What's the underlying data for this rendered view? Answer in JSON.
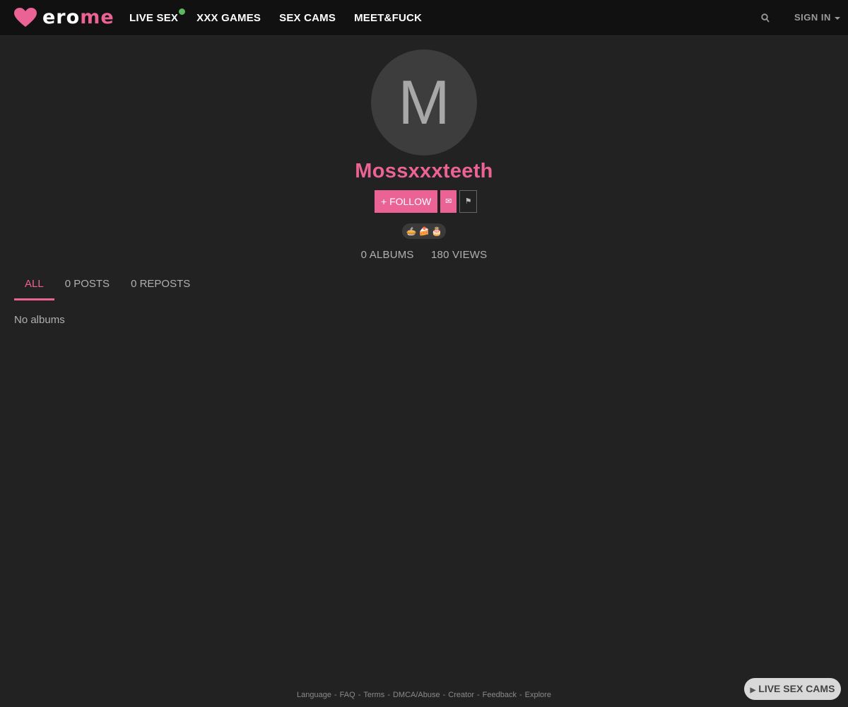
{
  "brand": {
    "name_white": "ero",
    "name_pink": "me"
  },
  "nav": [
    {
      "label": "LIVE SEX",
      "live": true
    },
    {
      "label": "XXX GAMES"
    },
    {
      "label": "SEX CAMS"
    },
    {
      "label": "MEET&FUCK"
    }
  ],
  "header": {
    "search_icon": "search-icon",
    "signin_label": "SIGN IN"
  },
  "profile": {
    "avatar_letter": "M",
    "username": "Mossxxxteeth",
    "follow_label": "+ FOLLOW",
    "badges": [
      "🥧",
      "🍰",
      "🎂"
    ],
    "albums_stat": "0 ALBUMS",
    "views_stat": "180 VIEWS"
  },
  "tabs": [
    {
      "label": "ALL",
      "active": true
    },
    {
      "label": "0 POSTS"
    },
    {
      "label": "0 REPOSTS"
    }
  ],
  "empty_message": "No albums",
  "footer": {
    "links": [
      "Language",
      "FAQ",
      "Terms",
      "DMCA/Abuse",
      "Creator",
      "Feedback",
      "Explore"
    ],
    "separator": "-"
  },
  "floating_button": {
    "label": "LIVE SEX CAMS"
  },
  "colors": {
    "accent": "#eb6395",
    "background": "#222222",
    "topbar": "#111111",
    "live_dot": "#5cb85c"
  }
}
